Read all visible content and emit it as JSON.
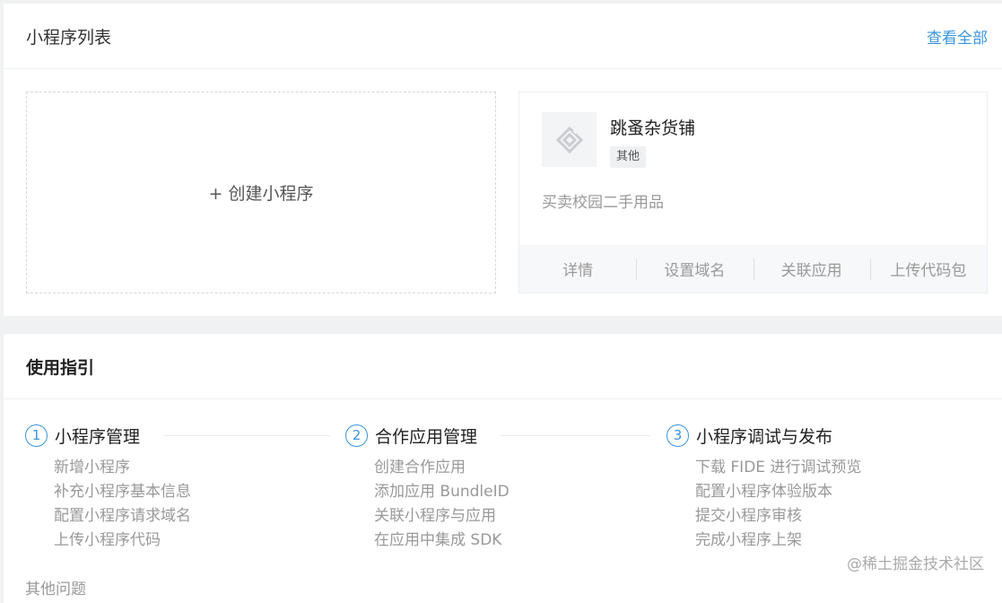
{
  "miniapps": {
    "title": "小程序列表",
    "view_all": "查看全部",
    "create_label": "+ 创建小程序",
    "card": {
      "name": "跳蚤杂货铺",
      "tag": "其他",
      "description": "买卖校园二手用品",
      "actions": [
        "详情",
        "设置域名",
        "关联应用",
        "上传代码包"
      ]
    }
  },
  "guide": {
    "title": "使用指引",
    "steps": [
      {
        "num": "1",
        "title": "小程序管理",
        "links": [
          "新增小程序",
          "补充小程序基本信息",
          "配置小程序请求域名",
          "上传小程序代码"
        ]
      },
      {
        "num": "2",
        "title": "合作应用管理",
        "links": [
          "创建合作应用",
          "添加应用 BundleID",
          "关联小程序与应用",
          "在应用中集成 SDK"
        ]
      },
      {
        "num": "3",
        "title": "小程序调试与发布",
        "links": [
          "下载 FIDE 进行调试预览",
          "配置小程序体验版本",
          "提交小程序审核",
          "完成小程序上架"
        ]
      }
    ],
    "other": "其他问题"
  },
  "watermark": "@稀土掘金技术社区"
}
